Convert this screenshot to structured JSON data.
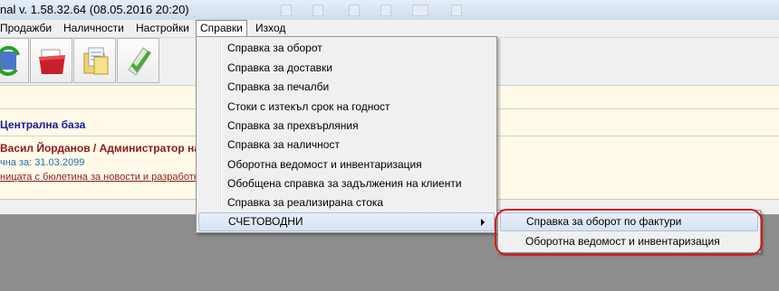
{
  "window": {
    "title": "nal v. 1.58.32.64 (08.05.2016 20:20)"
  },
  "menubar": [
    {
      "label": "Продажби"
    },
    {
      "label": "Наличности"
    },
    {
      "label": "Настройки"
    },
    {
      "label": "Справки"
    },
    {
      "label": "Изход"
    }
  ],
  "toolbar": {
    "buttons": [
      {
        "icon": "refresh-icon"
      },
      {
        "icon": "folder-red-icon"
      },
      {
        "icon": "folder-documents-icon"
      },
      {
        "icon": "checklist-icon"
      }
    ]
  },
  "content": {
    "database": "Централна база",
    "user": "Васил Йорданов / Администратор на",
    "valid_until": "чна за: 31.03.2099",
    "newsletter_link": "ницата с бюлетина за новости и разработк"
  },
  "reports_menu": [
    {
      "label": "Справка за оборот"
    },
    {
      "label": "Справка за доставки"
    },
    {
      "label": "Справка за печалби"
    },
    {
      "label": "Стоки с изтекъл срок на годност"
    },
    {
      "label": "Справка за прехвърляния"
    },
    {
      "label": "Справка за наличност"
    },
    {
      "label": "Оборотна ведомост и инвентаризация"
    },
    {
      "label": "Обобщена справка за задължения на клиенти"
    },
    {
      "label": "Справка за реализирана стока"
    },
    {
      "label": "СЧЕТОВОДНИ"
    }
  ],
  "accounting_submenu": [
    {
      "label": "Справка за оборот по фактури"
    },
    {
      "label": "Оборотна ведомост и инвентаризация"
    }
  ],
  "colors": {
    "highlight_mark": "#d81818",
    "database_text": "#1a1a9a",
    "user_text": "#8b1a1a"
  }
}
